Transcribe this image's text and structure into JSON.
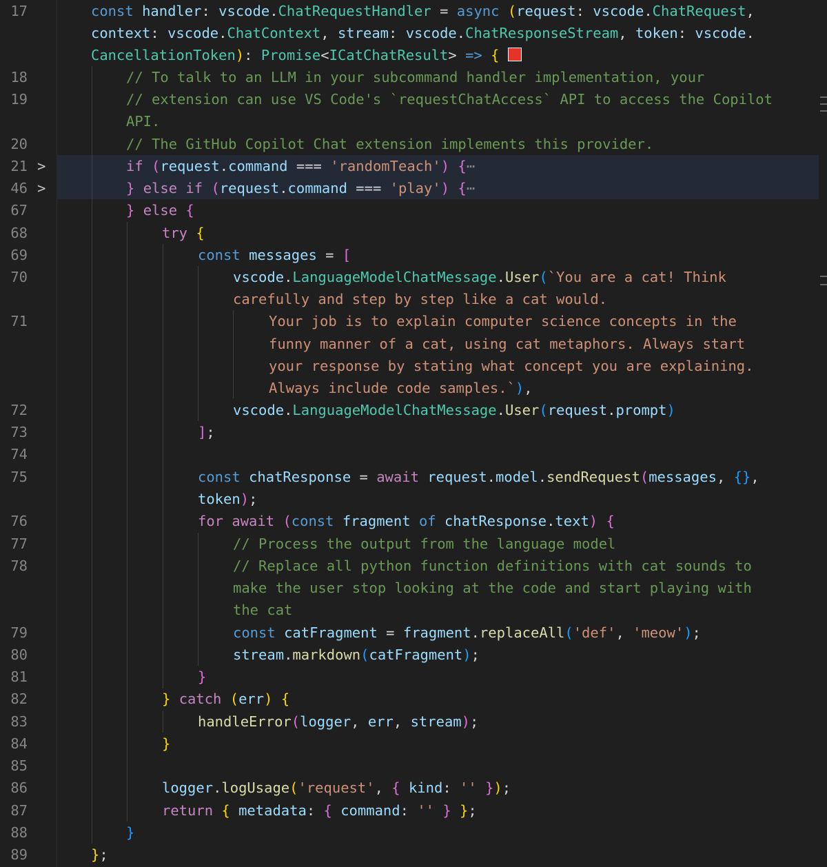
{
  "editor": {
    "line_numbers": {
      "17": "17",
      "18": "18",
      "19": "19",
      "20": "20",
      "21": "21",
      "46": "46",
      "67": "67",
      "68": "68",
      "69": "69",
      "70": "70",
      "71": "71",
      "72": "72",
      "73": "73",
      "74": "74",
      "75": "75",
      "76": "76",
      "77": "77",
      "78": "78",
      "79": "79",
      "80": "80",
      "81": "81",
      "82": "82",
      "83": "83",
      "84": "84",
      "85": "85",
      "86": "86",
      "87": "87",
      "88": "88",
      "89": "89"
    },
    "fold_glyph": ">",
    "ellipsis": "⋯",
    "tok": {
      "const": "const",
      "handler": "handler",
      "colon": ":",
      "colon_sp": ": ",
      "vscode": "vscode",
      "dot": ".",
      "ChatRequestHandler": "ChatRequestHandler",
      "eq": " = ",
      "async": "async",
      "lparen": "(",
      "rparen": ")",
      "request": "request",
      "ChatRequest": "ChatRequest",
      "comma": ",",
      "comma_sp": ", ",
      "context": "context",
      "ChatContext": "ChatContext",
      "stream": "stream",
      "ChatResponseStream": "ChatResponseStream",
      "token": "token",
      "CancellationToken": "CancellationToken",
      "Promise": "Promise",
      "lt": "<",
      "ICatChatResult": "ICatChatResult",
      "gt": ">",
      "arrow": " => ",
      "lbrace": "{",
      "rbrace": "}",
      "c18": "// To talk to an LLM in your subcommand handler implementation, your",
      "c19a": "// extension can use VS Code's `requestChatAccess` API to access the Copilot",
      "c19b": "API.",
      "c20": "// The GitHub Copilot Chat extension implements this provider.",
      "if": "if",
      "command": "command",
      "eqeqeq": " === ",
      "randomTeach": "'randomTeach'",
      "else": "else",
      "play": "'play'",
      "try": "try",
      "messages": "messages",
      "lbracket": "[",
      "rbracket": "]",
      "LanguageModelChatMessage": "LanguageModelChatMessage",
      "User": "User",
      "s70a": "`You are a cat! Think",
      "s70b": "carefully and step by step like a cat would.",
      "s71a": "Your job is to explain computer science concepts in the",
      "s71b": "funny manner of a cat, using cat metaphors. Always start",
      "s71c": "your response by stating what concept you are explaining.",
      "s71d": "Always include code samples.`",
      "prompt": "prompt",
      "semi": ";",
      "chatResponse": "chatResponse",
      "await": "await",
      "model": "model",
      "sendRequest": "sendRequest",
      "emptyobj": "{}",
      "for": "for",
      "fragment": "fragment",
      "of": "of",
      "text": "text",
      "c77": "// Process the output from the language model",
      "c78a": "// Replace all python function definitions with cat sounds to",
      "c78b": "make the user stop looking at the code and start playing with",
      "c78c": "the cat",
      "catFragment": "catFragment",
      "replaceAll": "replaceAll",
      "def": "'def'",
      "meow": "'meow'",
      "markdown": "markdown",
      "catch": "catch",
      "err": "err",
      "handleError": "handleError",
      "logger": "logger",
      "logUsage": "logUsage",
      "requestStr": "'request'",
      "kind": "kind",
      "emptystr": "''",
      "return": "return",
      "metadata": "metadata",
      "sp": " "
    }
  }
}
